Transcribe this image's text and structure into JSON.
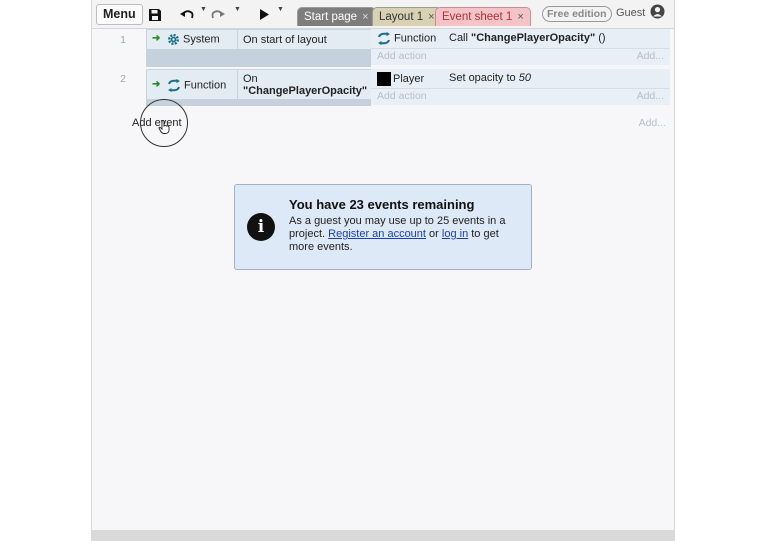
{
  "toolbar": {
    "menu_label": "Menu",
    "tabs": [
      {
        "label": "Start page",
        "close": "×"
      },
      {
        "label": "Layout 1",
        "close": "×"
      },
      {
        "label": "Event sheet 1",
        "close": "×"
      }
    ],
    "edition_badge": "Free edition",
    "user_label": "Guest"
  },
  "events": [
    {
      "number": "1",
      "condition_object": "System",
      "condition_text": "On start of layout",
      "actions": [
        {
          "object": "Function",
          "text_prefix": "Call ",
          "text_bold": "\"ChangePlayerOpacity\"",
          "text_suffix": " ()"
        }
      ],
      "add_action": "Add action",
      "add_right": "Add..."
    },
    {
      "number": "2",
      "condition_object": "Function",
      "condition_line1": "On",
      "condition_line2": "\"ChangePlayerOpacity\"",
      "actions": [
        {
          "object": "Player",
          "text_prefix": "Set opacity to ",
          "text_italic": "50"
        }
      ],
      "add_action": "Add action",
      "add_right": "Add..."
    }
  ],
  "add_event": "Add event",
  "add_event_right": "Add...",
  "notice": {
    "title": "You have 23 events remaining",
    "body_1": "As a guest you may use up to 25 events in a project. ",
    "link_register": "Register an account",
    "body_2": " or ",
    "link_login": "log in",
    "body_3": " to get more events."
  },
  "colors": {
    "accent_tab": "#f3c3c8",
    "event_bg": "#e3ebf3",
    "notice_bg": "#dde9f6",
    "link": "#1a3fb8"
  }
}
